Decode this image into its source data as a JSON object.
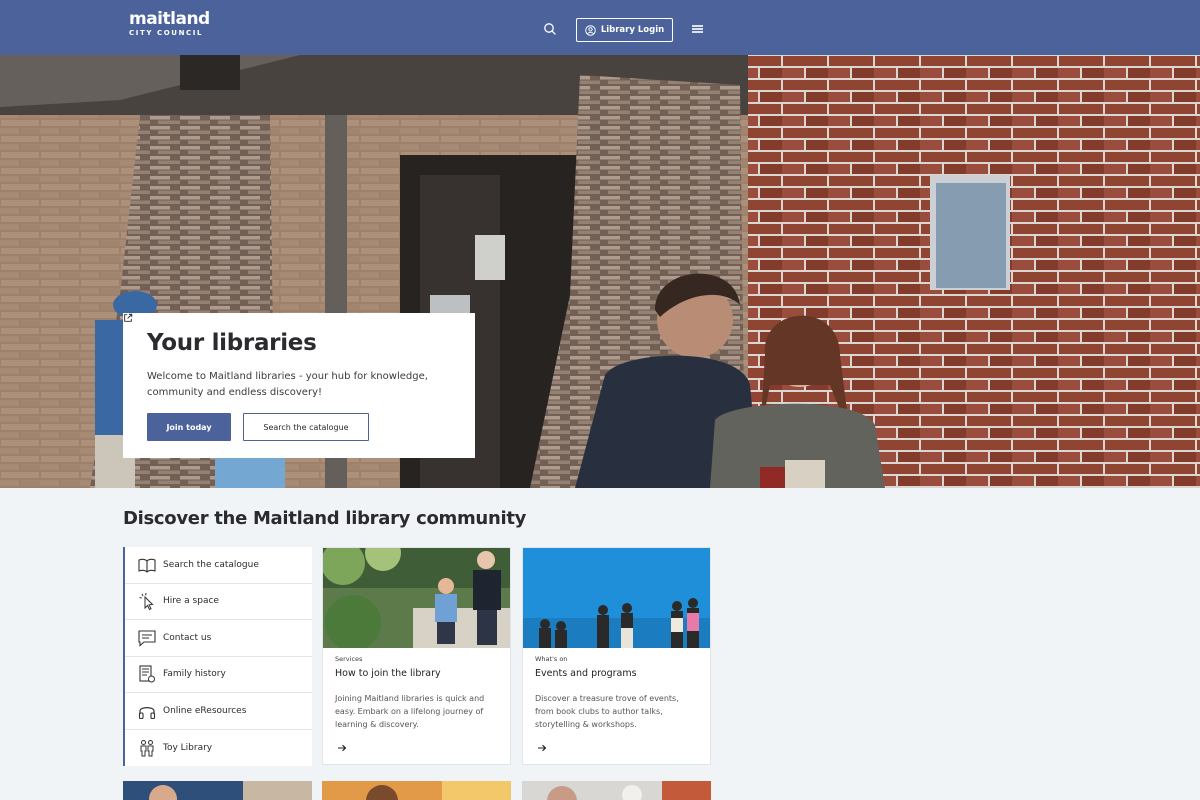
{
  "header": {
    "logo_main": "maitland",
    "logo_sub": "CITY COUNCIL",
    "login_label": "Library Login",
    "icons": {
      "search": "search-icon",
      "user": "user-circle-icon",
      "menu": "hamburger-icon"
    }
  },
  "hero": {
    "title": "Your libraries",
    "text": "Welcome to Maitland libraries - your hub for knowledge, community and endless discovery!",
    "join_label": "Join today",
    "search_label": "Search the catalogue"
  },
  "discover": {
    "title": "Discover the Maitland library community",
    "quick_links": [
      {
        "label": "Search the catalogue",
        "icon": "book-icon"
      },
      {
        "label": "Hire a space",
        "icon": "pointer-click-icon"
      },
      {
        "label": "Contact us",
        "icon": "chat-icon"
      },
      {
        "label": "Family history",
        "icon": "document-hand-icon"
      },
      {
        "label": "Online eResources",
        "icon": "headphones-icon"
      },
      {
        "label": "Toy Library",
        "icon": "people-icon"
      }
    ],
    "cards": [
      {
        "tag": "Services",
        "title": "How to join the library",
        "text": "Joining Maitland libraries is quick and easy. Embark on a lifelong journey of learning & discovery."
      },
      {
        "tag": "What's on",
        "title": "Events and programs",
        "text": "Discover a treasure trove of events, from book clubs to author talks, storytelling & workshops."
      }
    ]
  },
  "colors": {
    "brand": "#4b639a",
    "page_bg": "#f1f4f7",
    "card_bg": "#ffffff"
  }
}
